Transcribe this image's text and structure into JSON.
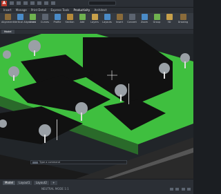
{
  "app": {
    "logo_letter": "A"
  },
  "menu": {
    "items": [
      "Insert",
      "Manage",
      "Print Detail",
      "Express Tools",
      "Productivity",
      "Architect"
    ]
  },
  "ribbon": {
    "tools": [
      "Alignment",
      "Vertical Alignment",
      "Lines",
      "Curves",
      "Profile",
      "Section",
      "Add",
      "Layers",
      "Layouts",
      "Insert",
      "Convert",
      "Zoom",
      "Group",
      "3D",
      "Layer",
      "Modify",
      "Leaders",
      "Drawing"
    ]
  },
  "statusbar": {
    "layout_tabs": [
      "Model",
      "Layout1",
      "Layout2",
      "+"
    ],
    "coords": "NEUTRAL MODE 1:1",
    "zoom": "1:1"
  },
  "commandline": {
    "placeholder": "Type a command"
  },
  "colors": {
    "accent": "#4aa3ff",
    "ground": "#3fbf3f",
    "road": "#202020"
  }
}
